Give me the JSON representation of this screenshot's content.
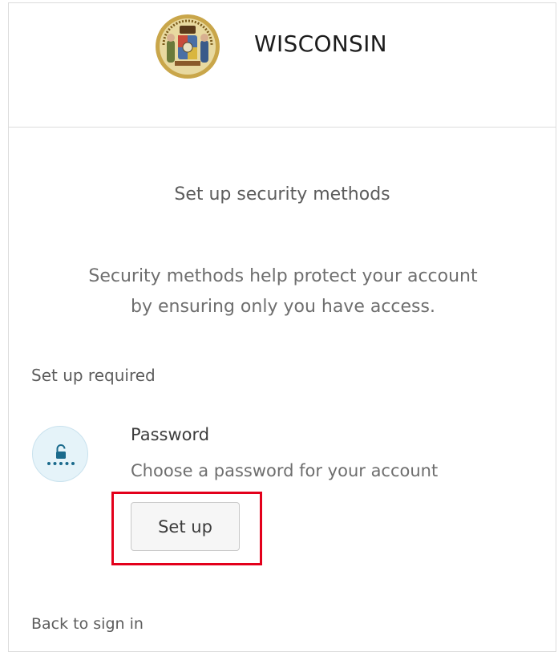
{
  "header": {
    "org_name": "WISCONSIN",
    "logo_icon": "wisconsin-state-seal-icon"
  },
  "main": {
    "title": "Set up security methods",
    "subtitle_line1": "Security methods help protect your account",
    "subtitle_line2": "by ensuring only you have access.",
    "section_label": "Set up required",
    "methods": [
      {
        "icon": "password-lock-icon",
        "name": "Password",
        "description": "Choose a password for your account",
        "button_label": "Set up"
      }
    ],
    "back_link": "Back to sign in"
  },
  "colors": {
    "highlight": "#e3001b",
    "icon_bg": "#e5f3f9",
    "icon_fg": "#1a6a8c"
  }
}
